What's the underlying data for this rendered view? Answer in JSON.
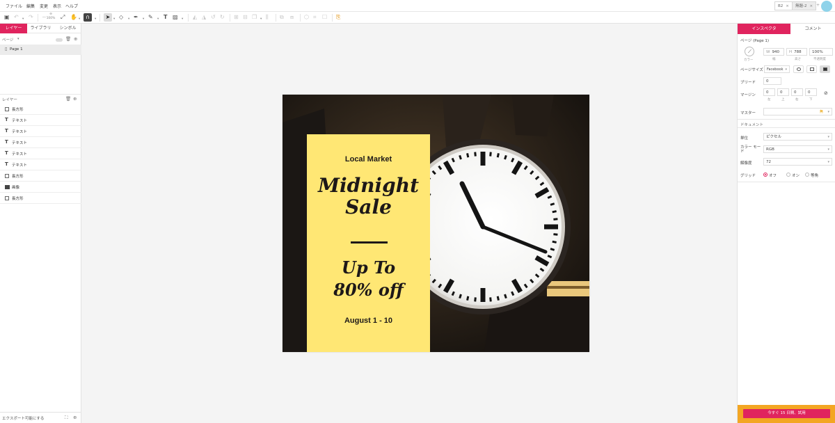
{
  "menu": [
    "ファイル",
    "編集",
    "変更",
    "表示",
    "ヘルプ"
  ],
  "doc_tabs": [
    {
      "label": "B2",
      "active": false
    },
    {
      "label": "無題-2",
      "active": true
    }
  ],
  "toolbar": {
    "zoom": "100%"
  },
  "left_panel": {
    "tabs": [
      "レイヤー",
      "ライブラリ",
      "シンボル"
    ],
    "active_tab": "レイヤー",
    "pages_label": "ページ",
    "pages": [
      "Page 1"
    ],
    "layers_label": "レイヤー",
    "layers": [
      {
        "type": "rect",
        "label": "長方形"
      },
      {
        "type": "text",
        "label": "テキスト"
      },
      {
        "type": "text",
        "label": "テキスト"
      },
      {
        "type": "text",
        "label": "テキスト"
      },
      {
        "type": "text",
        "label": "テキスト"
      },
      {
        "type": "text",
        "label": "テキスト"
      },
      {
        "type": "rect",
        "label": "長方形"
      },
      {
        "type": "image",
        "label": "画像"
      },
      {
        "type": "rect",
        "label": "長方形"
      }
    ],
    "footer": "エクスポート可能にする"
  },
  "artboard": {
    "line1": "Local Market",
    "line2": "Midnight",
    "line3": "Sale",
    "line4": "Up To",
    "line5": "80% off",
    "line6": "August 1 - 10",
    "panel_color": "#ffe774",
    "text_color": "#1d1818"
  },
  "inspector": {
    "tabs": [
      "インスペクタ",
      "コメント"
    ],
    "active_tab": "インスペクタ",
    "page_title": "ページ (Page 1)",
    "color_label": "カラー",
    "w_prefix": "W",
    "w_value": "940",
    "w_label": "幅",
    "h_prefix": "H",
    "h_value": "788",
    "h_label": "高さ",
    "opacity_value": "100%",
    "opacity_label": "不透明度",
    "page_size_label": "ページサイズ",
    "page_size_value": "Facebook",
    "bleed_label": "ブリード",
    "bleed_value": "0",
    "margin_label": "マージン",
    "margins": [
      {
        "value": "0",
        "label": "左"
      },
      {
        "value": "0",
        "label": "上"
      },
      {
        "value": "0",
        "label": "右"
      },
      {
        "value": "0",
        "label": "下"
      }
    ],
    "master_label": "マスター",
    "master_value": "無",
    "document_section": "ドキュメント",
    "unit_label": "単位",
    "unit_value": "ピクセル",
    "color_mode_label": "カラー モード",
    "color_mode_value": "RGB",
    "resolution_label": "解像度",
    "resolution_value": "72",
    "grid_label": "グリッド",
    "grid_options": [
      "オフ",
      "オン",
      "等角"
    ],
    "grid_selected": "オフ",
    "trial_button": "今すぐ 15 日間、試用"
  },
  "colors": {
    "accent": "#e0245e",
    "trial_bar": "#f3a623"
  }
}
